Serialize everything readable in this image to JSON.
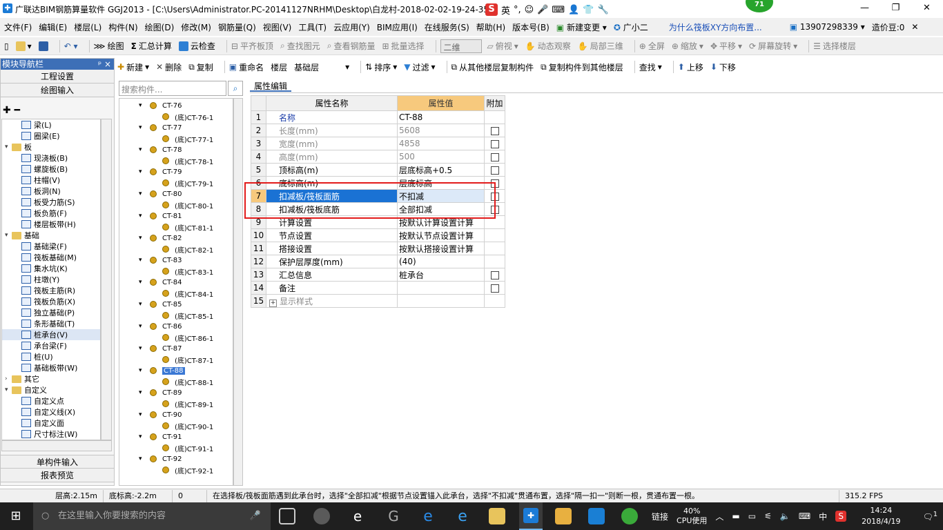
{
  "window": {
    "title": "广联达BIM钢筋算量软件 GGJ2013 - [C:\\Users\\Administrator.PC-20141127NRHM\\Desktop\\白龙村-2018-02-02-19-24-35",
    "ime_label": "英",
    "badge_value": "71",
    "min_icon": "—",
    "max_icon": "❐",
    "close_icon": "✕"
  },
  "menu": {
    "items": [
      "文件(F)",
      "编辑(E)",
      "楼层(L)",
      "构件(N)",
      "绘图(D)",
      "修改(M)",
      "钢筋量(Q)",
      "视图(V)",
      "工具(T)",
      "云应用(Y)",
      "BIM应用(I)",
      "在线服务(S)",
      "帮助(H)",
      "版本号(B)"
    ],
    "new_change": "新建变更",
    "assistant": "广小二",
    "question": "为什么筏板XY方向布置...",
    "phone": "13907298339",
    "price": "造价豆:0"
  },
  "toolbar1": {
    "draw": "绘图",
    "sum": "汇总计算",
    "cloud_check": "云检查",
    "flat_top": "平齐板顶",
    "find_elem": "查找图元",
    "view_rebar": "查看钢筋量",
    "batch_select": "批量选择",
    "view_mode": "二维",
    "top_view": "俯视",
    "dyn_obs": "动态观察",
    "local_3d": "局部三维",
    "fullscreen": "全屏",
    "zoom": "缩放",
    "pan": "平移",
    "rotate": "屏幕旋转",
    "select_floor": "选择楼层"
  },
  "toolbar2": {
    "new": "新建",
    "delete": "删除",
    "copy": "复制",
    "rename": "重命名",
    "floor_label": "楼层",
    "floor_value": "基础层",
    "sort": "排序",
    "filter": "过滤",
    "copy_from": "从其他楼层复制构件",
    "copy_to": "复制构件到其他楼层",
    "find": "查找",
    "up": "上移",
    "down": "下移"
  },
  "nav": {
    "title": "模块导航栏",
    "pin": "ᵖ ×",
    "project_settings": "工程设置",
    "drawing_input": "绘图输入",
    "single_input": "单构件输入",
    "report_preview": "报表预览",
    "tree": [
      {
        "label": "梁(L)",
        "type": "item"
      },
      {
        "label": "圈梁(E)",
        "type": "item"
      },
      {
        "label": "板",
        "type": "folder"
      },
      {
        "label": "现浇板(B)",
        "type": "item"
      },
      {
        "label": "螺旋板(B)",
        "type": "item"
      },
      {
        "label": "柱帽(V)",
        "type": "item"
      },
      {
        "label": "板洞(N)",
        "type": "item"
      },
      {
        "label": "板受力筋(S)",
        "type": "item"
      },
      {
        "label": "板负筋(F)",
        "type": "item"
      },
      {
        "label": "楼层板带(H)",
        "type": "item"
      },
      {
        "label": "基础",
        "type": "folder"
      },
      {
        "label": "基础梁(F)",
        "type": "item"
      },
      {
        "label": "筏板基础(M)",
        "type": "item"
      },
      {
        "label": "集水坑(K)",
        "type": "item"
      },
      {
        "label": "柱墩(Y)",
        "type": "item"
      },
      {
        "label": "筏板主筋(R)",
        "type": "item"
      },
      {
        "label": "筏板负筋(X)",
        "type": "item"
      },
      {
        "label": "独立基础(P)",
        "type": "item"
      },
      {
        "label": "条形基础(T)",
        "type": "item"
      },
      {
        "label": "桩承台(V)",
        "type": "item",
        "selected": true
      },
      {
        "label": "承台梁(F)",
        "type": "item"
      },
      {
        "label": "桩(U)",
        "type": "item"
      },
      {
        "label": "基础板带(W)",
        "type": "item"
      },
      {
        "label": "其它",
        "type": "folder-closed"
      },
      {
        "label": "自定义",
        "type": "folder"
      },
      {
        "label": "自定义点",
        "type": "item"
      },
      {
        "label": "自定义线(X)",
        "type": "item"
      },
      {
        "label": "自定义面",
        "type": "item"
      },
      {
        "label": "尺寸标注(W)",
        "type": "item"
      }
    ]
  },
  "components": {
    "search_placeholder": "搜索构件...",
    "rows": [
      {
        "label": "CT-76",
        "child": false
      },
      {
        "label": "(底)CT-76-1",
        "child": true
      },
      {
        "label": "CT-77",
        "child": false
      },
      {
        "label": "(底)CT-77-1",
        "child": true
      },
      {
        "label": "CT-78",
        "child": false
      },
      {
        "label": "(底)CT-78-1",
        "child": true
      },
      {
        "label": "CT-79",
        "child": false
      },
      {
        "label": "(底)CT-79-1",
        "child": true
      },
      {
        "label": "CT-80",
        "child": false
      },
      {
        "label": "(底)CT-80-1",
        "child": true
      },
      {
        "label": "CT-81",
        "child": false
      },
      {
        "label": "(底)CT-81-1",
        "child": true
      },
      {
        "label": "CT-82",
        "child": false
      },
      {
        "label": "(底)CT-82-1",
        "child": true
      },
      {
        "label": "CT-83",
        "child": false
      },
      {
        "label": "(底)CT-83-1",
        "child": true
      },
      {
        "label": "CT-84",
        "child": false
      },
      {
        "label": "(底)CT-84-1",
        "child": true
      },
      {
        "label": "CT-85",
        "child": false
      },
      {
        "label": "(底)CT-85-1",
        "child": true
      },
      {
        "label": "CT-86",
        "child": false
      },
      {
        "label": "(底)CT-86-1",
        "child": true
      },
      {
        "label": "CT-87",
        "child": false
      },
      {
        "label": "(底)CT-87-1",
        "child": true
      },
      {
        "label": "CT-88",
        "child": false,
        "selected": true
      },
      {
        "label": "(底)CT-88-1",
        "child": true
      },
      {
        "label": "CT-89",
        "child": false
      },
      {
        "label": "(底)CT-89-1",
        "child": true
      },
      {
        "label": "CT-90",
        "child": false
      },
      {
        "label": "(底)CT-90-1",
        "child": true
      },
      {
        "label": "CT-91",
        "child": false
      },
      {
        "label": "(底)CT-91-1",
        "child": true
      },
      {
        "label": "CT-92",
        "child": false
      },
      {
        "label": "(底)CT-92-1",
        "child": true
      }
    ]
  },
  "attr": {
    "tab": "属性编辑",
    "headers": {
      "name": "属性名称",
      "value": "属性值",
      "extra": "附加"
    },
    "rows": [
      {
        "n": "1",
        "name": "名称",
        "value": "CT-88",
        "style": "blue",
        "check": false
      },
      {
        "n": "2",
        "name": "长度(mm)",
        "value": "5608",
        "style": "gray",
        "check": true
      },
      {
        "n": "3",
        "name": "宽度(mm)",
        "value": "4858",
        "style": "gray",
        "check": true
      },
      {
        "n": "4",
        "name": "高度(mm)",
        "value": "500",
        "style": "gray",
        "check": true
      },
      {
        "n": "5",
        "name": "顶标高(m)",
        "value": "层底标高+0.5",
        "style": "",
        "check": true
      },
      {
        "n": "6",
        "name": "底标高(m)",
        "value": "层底标高",
        "style": "",
        "check": true
      },
      {
        "n": "7",
        "name": "扣减板/筏板面筋",
        "value": "不扣减",
        "style": "",
        "check": true,
        "selected": true
      },
      {
        "n": "8",
        "name": "扣减板/筏板底筋",
        "value": "全部扣减",
        "style": "",
        "check": true
      },
      {
        "n": "9",
        "name": "计算设置",
        "value": "按默认计算设置计算",
        "style": "",
        "check": false
      },
      {
        "n": "10",
        "name": "节点设置",
        "value": "按默认节点设置计算",
        "style": "",
        "check": false
      },
      {
        "n": "11",
        "name": "搭接设置",
        "value": "按默认搭接设置计算",
        "style": "",
        "check": false
      },
      {
        "n": "12",
        "name": "保护层厚度(mm)",
        "value": "(40)",
        "style": "",
        "check": false
      },
      {
        "n": "13",
        "name": "汇总信息",
        "value": "桩承台",
        "style": "",
        "check": true
      },
      {
        "n": "14",
        "name": "备注",
        "value": "",
        "style": "",
        "check": true
      },
      {
        "n": "15",
        "name": "显示样式",
        "value": "",
        "style": "gray",
        "check": false,
        "expand": "+"
      }
    ]
  },
  "status": {
    "floor_height": "层高:2.15m",
    "bottom_elev": "底标高:-2.2m",
    "zero": "0",
    "message": "在选择板/筏板面筋遇到此承台时，选择\"全部扣减\"根据节点设置锚入此承台，选择\"不扣减\"贯通布置，选择\"隔一扣一\"则断一根，贯通布置一根。",
    "fps": "315.2 FPS"
  },
  "taskbar": {
    "search_placeholder": "在这里输入你要搜索的内容",
    "link": "链接",
    "cpu_pct": "40%",
    "cpu_label": "CPU使用",
    "lang": "中",
    "time": "14:24",
    "date": "2018/4/19",
    "notif": "1"
  }
}
